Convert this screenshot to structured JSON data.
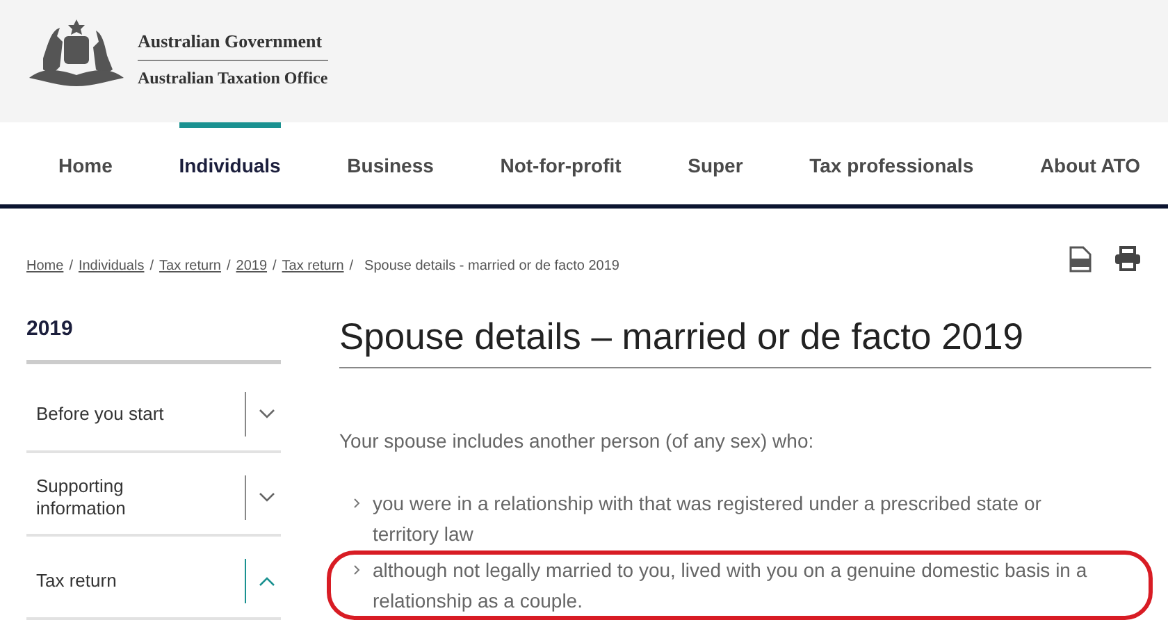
{
  "header": {
    "agency_lines": [
      "Australian Government",
      "Australian Taxation Office"
    ]
  },
  "nav": [
    {
      "label": "Home",
      "selected": false
    },
    {
      "label": "Individuals",
      "selected": true
    },
    {
      "label": "Business",
      "selected": false
    },
    {
      "label": "Not-for-profit",
      "selected": false
    },
    {
      "label": "Super",
      "selected": false
    },
    {
      "label": "Tax professionals",
      "selected": false
    },
    {
      "label": "About ATO",
      "selected": false
    }
  ],
  "breadcrumb": {
    "separator": "/",
    "links": [
      "Home",
      "Individuals",
      "Tax return",
      "2019",
      "Tax return"
    ],
    "current": "Spouse details - married or de facto 2019"
  },
  "sidebar": {
    "title": "2019",
    "items": [
      {
        "label": "Before you start",
        "expanded": false
      },
      {
        "label": "Supporting information",
        "expanded": false
      },
      {
        "label": "Tax return",
        "expanded": true
      }
    ]
  },
  "content": {
    "title": "Spouse details – married or de facto 2019",
    "intro": "Your spouse includes another person (of any sex) who:",
    "bullets": [
      {
        "text": "you were in a relationship with that was registered under a prescribed state or territory law",
        "highlighted": false
      },
      {
        "text": "although not legally married to you, lived with you on a genuine domestic basis in a relationship as a couple.",
        "highlighted": true
      }
    ]
  }
}
